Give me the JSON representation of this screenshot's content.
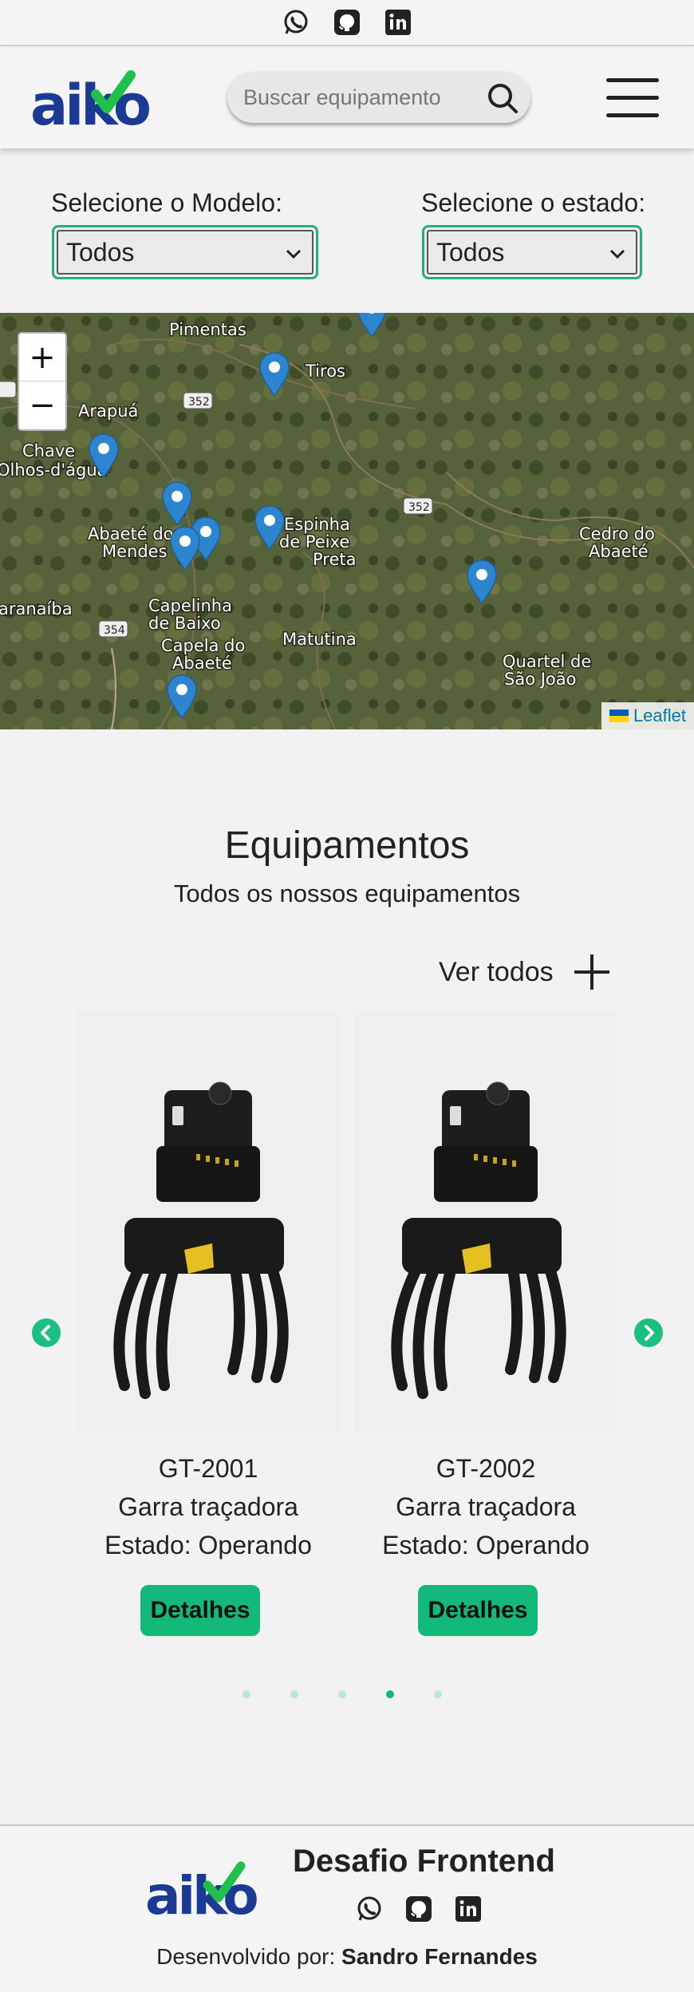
{
  "top_social": {
    "icons": [
      "whatsapp-icon",
      "github-icon",
      "linkedin-icon"
    ]
  },
  "header": {
    "logo_text": "aiko",
    "search_placeholder": "Buscar equipamento"
  },
  "filters": {
    "model_label": "Selecione o Modelo:",
    "model_value": "Todos",
    "state_label": "Selecione o estado:",
    "state_value": "Todos"
  },
  "map": {
    "zoom_in": "+",
    "zoom_out": "−",
    "attribution": "Leaflet",
    "places": [
      "Pimentas",
      "Tiros",
      "Arapuá",
      "Chave",
      "Olhos-d'água",
      "Abaeté dos",
      "Mendes",
      "Espinha",
      "de Peixe",
      "Preta",
      "Cedro do",
      "Abaeté",
      "aranaíba",
      "Capelinha",
      "de Baixo",
      "Capela do",
      "Abaeté",
      "Matutina",
      "Quartel de",
      "São João"
    ],
    "road_shields": [
      "352",
      "352",
      "354"
    ]
  },
  "equipments": {
    "title": "Equipamentos",
    "subtitle": "Todos os nossos equipamentos",
    "see_all": "Ver todos",
    "cards": [
      {
        "name": "GT-2001",
        "type": "Garra traçadora",
        "state": "Estado: Operando",
        "button": "Detalhes"
      },
      {
        "name": "GT-2002",
        "type": "Garra traçadora",
        "state": "Estado: Operando",
        "button": "Detalhes"
      }
    ],
    "dots_count": 5,
    "active_dot": 4
  },
  "footer": {
    "logo_text": "aiko",
    "title": "Desafio Frontend",
    "dev_prefix": "Desenvolvido por:",
    "dev_name": "Sandro Fernandes"
  },
  "colors": {
    "accent": "#12b978",
    "logo_blue": "#1b3a94",
    "logo_green": "#21c04a"
  }
}
